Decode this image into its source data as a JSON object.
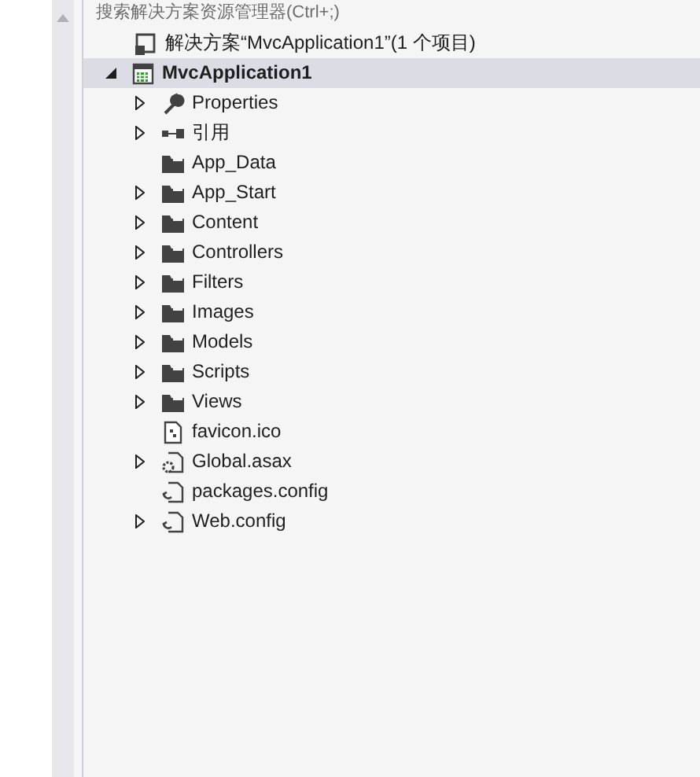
{
  "search": {
    "placeholder": "搜索解决方案资源管理器(Ctrl+;)"
  },
  "solution": {
    "label": "解决方案“MvcApplication1”(1 个项目)"
  },
  "project": {
    "label": "MvcApplication1",
    "expanded": true,
    "selected": true,
    "children": [
      {
        "label": "Properties",
        "kind": "properties",
        "expandable": true
      },
      {
        "label": "引用",
        "kind": "references",
        "expandable": true
      },
      {
        "label": "App_Data",
        "kind": "folder",
        "expandable": false
      },
      {
        "label": "App_Start",
        "kind": "folder",
        "expandable": true
      },
      {
        "label": "Content",
        "kind": "folder",
        "expandable": true
      },
      {
        "label": "Controllers",
        "kind": "folder",
        "expandable": true
      },
      {
        "label": "Filters",
        "kind": "folder",
        "expandable": true
      },
      {
        "label": "Images",
        "kind": "folder",
        "expandable": true
      },
      {
        "label": "Models",
        "kind": "folder",
        "expandable": true
      },
      {
        "label": "Scripts",
        "kind": "folder",
        "expandable": true
      },
      {
        "label": "Views",
        "kind": "folder",
        "expandable": true
      },
      {
        "label": "favicon.ico",
        "kind": "file",
        "expandable": false
      },
      {
        "label": "Global.asax",
        "kind": "asax",
        "expandable": true
      },
      {
        "label": "packages.config",
        "kind": "config",
        "expandable": false
      },
      {
        "label": "Web.config",
        "kind": "config",
        "expandable": true
      }
    ]
  }
}
